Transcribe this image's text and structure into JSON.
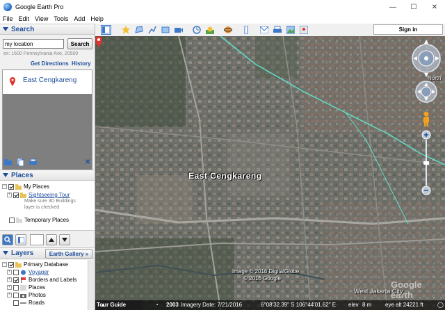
{
  "window": {
    "title": "Google Earth Pro",
    "minimize": "—",
    "maximize": "☐",
    "close": "✕"
  },
  "menu": [
    "File",
    "Edit",
    "View",
    "Tools",
    "Add",
    "Help"
  ],
  "search": {
    "header": "Search",
    "input_value": "my location",
    "button": "Search",
    "hint": "ex: 1600 Pennsylvania Ave, 20500",
    "get_directions": "Get Directions",
    "history": "History",
    "result": "East Cengkareng"
  },
  "places": {
    "header": "Places",
    "my_places": "My Places",
    "sightseeing_tour": "Sightseeing Tour",
    "tour_note_line1": "Make sure 3D Buildings",
    "tour_note_line2": "layer is checked",
    "temporary_places": "Temporary Places"
  },
  "layers": {
    "header": "Layers",
    "earth_gallery": "Earth Gallery",
    "earth_gallery_arrows": "»",
    "items": [
      "Primary Database",
      "Voyager",
      "Borders and Labels",
      "Places",
      "Photos",
      "Roads"
    ]
  },
  "toolbar": {
    "sign_in": "Sign in"
  },
  "map": {
    "place_label": "East Cengkareng",
    "copyright_line1": "Image © 2016 DigitalGlobe",
    "copyright_line2": "© 2016 Google",
    "city_label": "West Jakarta City",
    "north_label": "North",
    "google_logo": "Google earth"
  },
  "status": {
    "tour_guide": "Tour Guide",
    "year": "2003",
    "imagery_date": "Imagery Date: 7/21/2016",
    "coordinates": "6°08'32.39\" S  106°44'01.62\" E",
    "elev_label": "elev",
    "elev_value": "8 m",
    "eye_alt": "eye alt  24221 ft"
  },
  "icons": [
    "globe-app-icon",
    "map-pin-icon",
    "folder-icon",
    "arrow-up-icon",
    "arrow-down-icon",
    "look-joystick-icon",
    "move-joystick-icon",
    "pegman-icon",
    "zoom-plus-icon",
    "zoom-minus-icon"
  ],
  "colors": {
    "accent": "#1e4f9a",
    "pin": "#e0322c",
    "road_line": "#5fe0c8"
  }
}
